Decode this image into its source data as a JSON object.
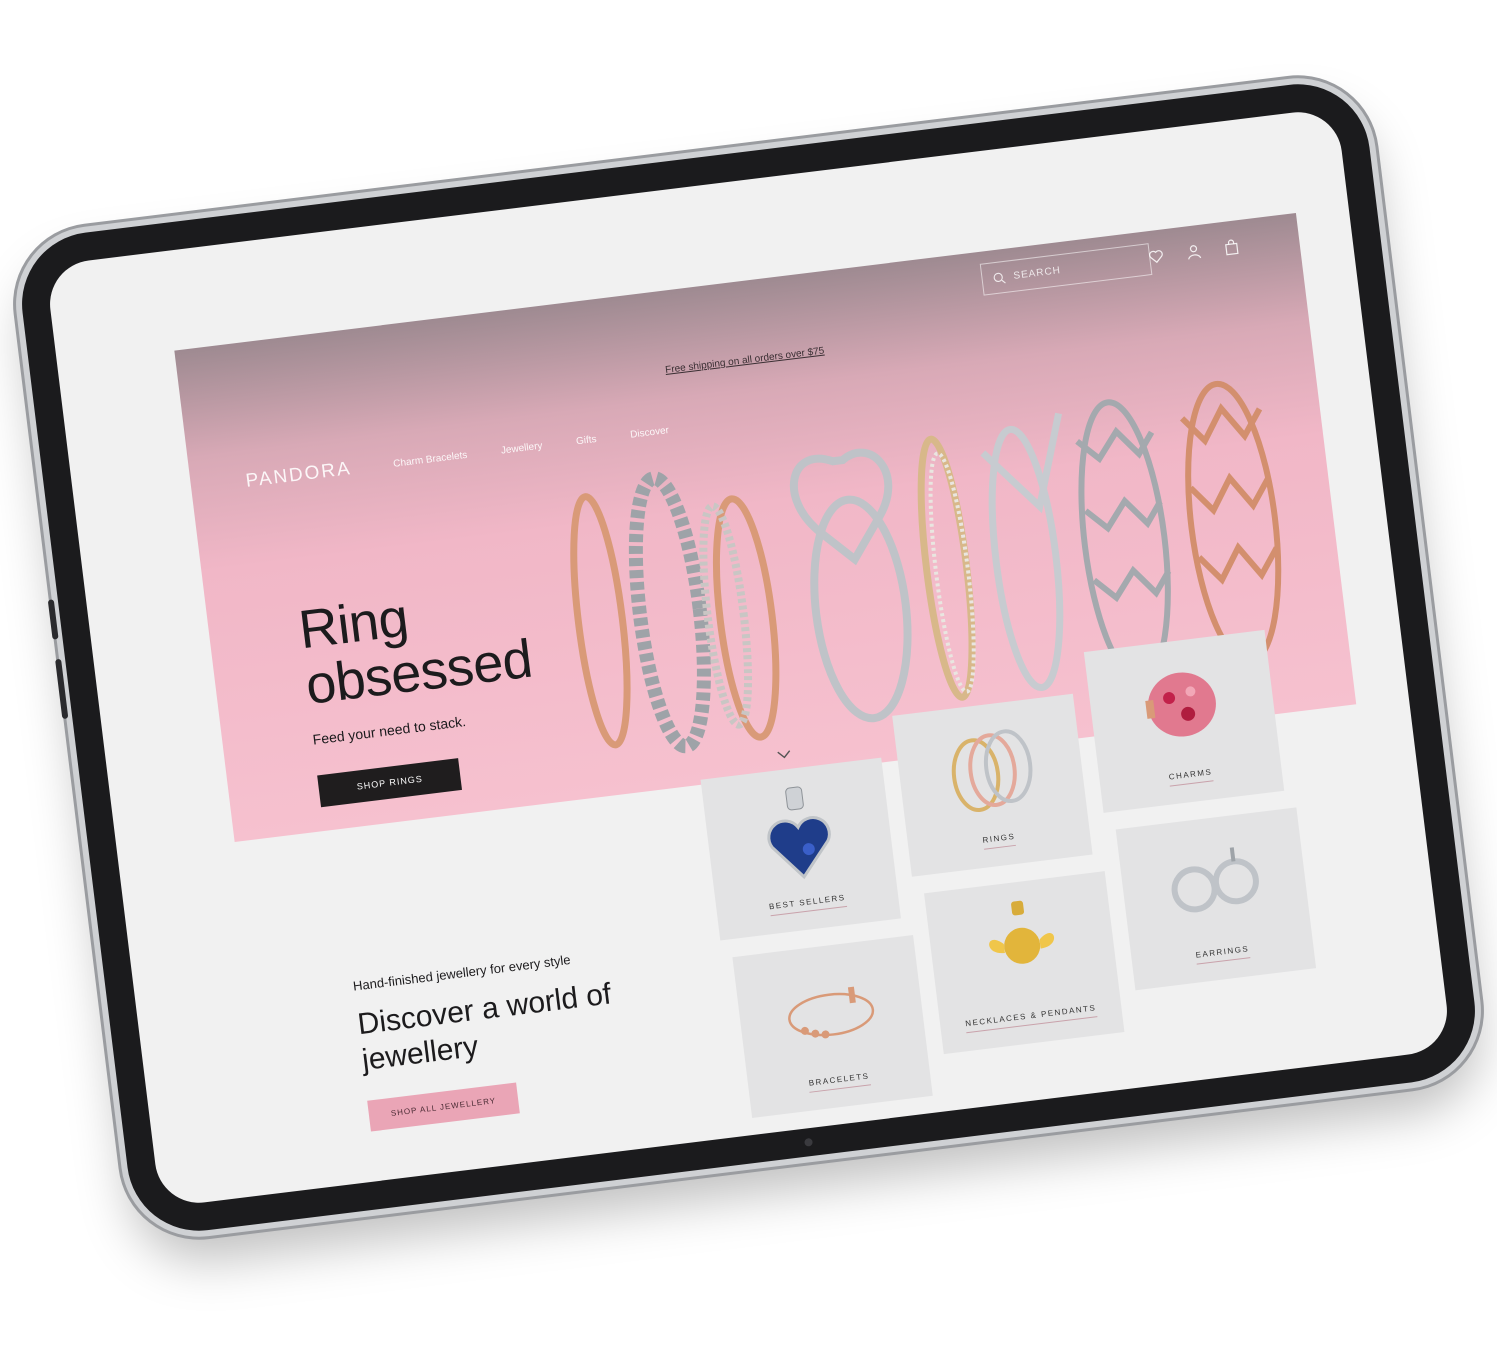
{
  "topbar": {
    "search_placeholder": "SEARCH",
    "icons": [
      "wishlist-icon",
      "account-icon",
      "bag-icon"
    ]
  },
  "promo": "Free shipping on all orders over $75",
  "nav": {
    "logo": "PANDORA",
    "items": [
      "Charm Bracelets",
      "Jewellery",
      "Gifts",
      "Discover"
    ]
  },
  "hero": {
    "title_line1": "Ring",
    "title_line2": "obsessed",
    "subtitle": "Feed your need to stack.",
    "cta": "SHOP RINGS"
  },
  "lower": {
    "kicker": "Hand-finished jewellery for every style",
    "title_line1": "Discover a world of",
    "title_line2": "jewellery",
    "cta": "SHOP ALL JEWELLERY"
  },
  "categories": [
    {
      "label": "BEST SELLERS",
      "icon": "heart-charm-icon"
    },
    {
      "label": "RINGS",
      "icon": "rings-icon"
    },
    {
      "label": "CHARMS",
      "icon": "bead-charm-icon"
    },
    {
      "label": "BRACELETS",
      "icon": "bracelet-icon"
    },
    {
      "label": "NECKLACES & PENDANTS",
      "icon": "pendant-icon"
    },
    {
      "label": "EARRINGS",
      "icon": "earrings-icon"
    }
  ],
  "colors": {
    "hero_pink": "#f6c1cf",
    "button_dark": "#1f1d1e",
    "button_pink": "#eaa5b6",
    "rose_gold": "#d99a78",
    "silver": "#bfc3c8"
  }
}
